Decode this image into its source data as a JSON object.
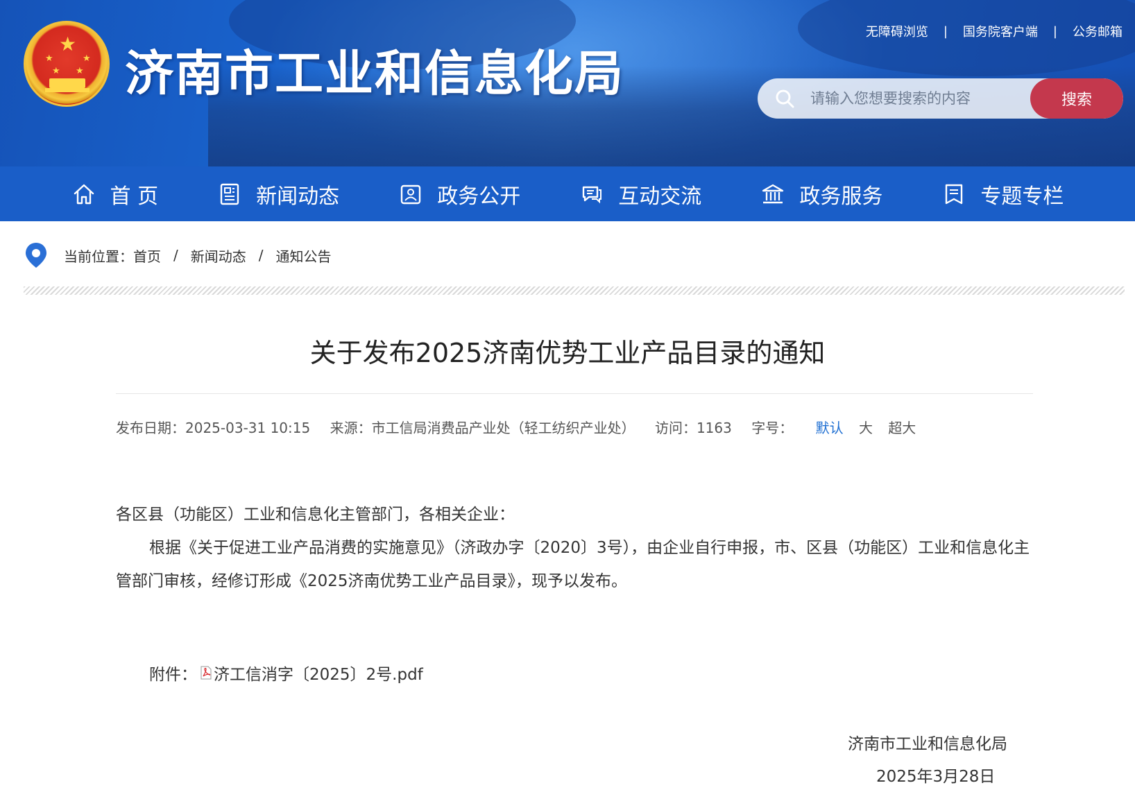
{
  "header": {
    "site_title": "济南市工业和信息化局",
    "links": [
      "无障碍浏览",
      "国务院客户端",
      "公务邮箱"
    ],
    "search_placeholder": "请输入您想要搜索的内容",
    "search_button": "搜索"
  },
  "nav": [
    {
      "label": "首 页",
      "icon": "home-icon"
    },
    {
      "label": "新闻动态",
      "icon": "news-icon"
    },
    {
      "label": "政务公开",
      "icon": "government-icon"
    },
    {
      "label": "互动交流",
      "icon": "chat-icon"
    },
    {
      "label": "政务服务",
      "icon": "building-icon"
    },
    {
      "label": "专题专栏",
      "icon": "column-icon"
    }
  ],
  "breadcrumb": {
    "prefix": "当前位置：",
    "items": [
      "首页",
      "新闻动态",
      "通知公告"
    ],
    "separator": "/"
  },
  "article": {
    "title": "关于发布2025济南优势工业产品目录的通知",
    "meta": {
      "date": "发布日期：2025-03-31 10:15",
      "source": "来源：市工信局消费品产业处（轻工纺织产业处）",
      "visits": "访问：1163",
      "font_label": "字号：",
      "font_sizes": [
        "默认",
        "大",
        "超大"
      ]
    },
    "salutation": "各区县（功能区）工业和信息化主管部门，各相关企业：",
    "paragraph": "根据《关于促进工业产品消费的实施意见》（济政办字〔2020〕3号），由企业自行申报，市、区县（功能区）工业和信息化主管部门审核，经修订形成《2025济南优势工业产品目录》，现予以发布。",
    "attachment_label": "附件：",
    "attachment_file": "济工信消字〔2025〕2号.pdf",
    "signature": "济南市工业和信息化局",
    "sign_date": "2025年3月28日"
  },
  "colors": {
    "nav_bg": "#1a5ec8",
    "search_button": "#c4384d",
    "active_font_size": "#1f6fd2"
  }
}
